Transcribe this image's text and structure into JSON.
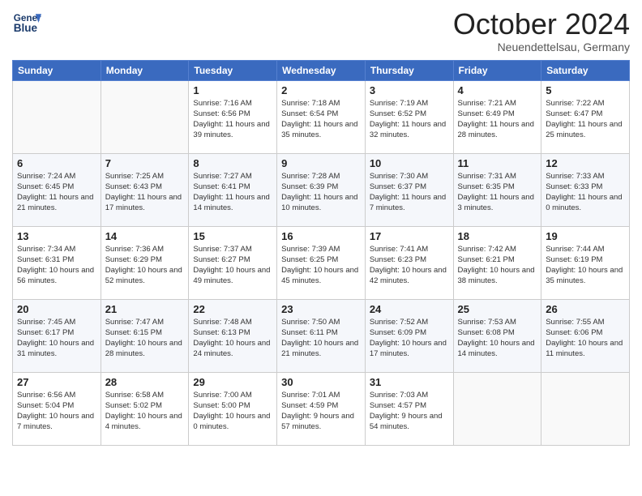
{
  "header": {
    "logo_general": "General",
    "logo_blue": "Blue",
    "title": "October 2024",
    "location": "Neuendettelsau, Germany"
  },
  "weekdays": [
    "Sunday",
    "Monday",
    "Tuesday",
    "Wednesday",
    "Thursday",
    "Friday",
    "Saturday"
  ],
  "weeks": [
    [
      {
        "day": "",
        "sunrise": "",
        "sunset": "",
        "daylight": ""
      },
      {
        "day": "",
        "sunrise": "",
        "sunset": "",
        "daylight": ""
      },
      {
        "day": "1",
        "sunrise": "Sunrise: 7:16 AM",
        "sunset": "Sunset: 6:56 PM",
        "daylight": "Daylight: 11 hours and 39 minutes."
      },
      {
        "day": "2",
        "sunrise": "Sunrise: 7:18 AM",
        "sunset": "Sunset: 6:54 PM",
        "daylight": "Daylight: 11 hours and 35 minutes."
      },
      {
        "day": "3",
        "sunrise": "Sunrise: 7:19 AM",
        "sunset": "Sunset: 6:52 PM",
        "daylight": "Daylight: 11 hours and 32 minutes."
      },
      {
        "day": "4",
        "sunrise": "Sunrise: 7:21 AM",
        "sunset": "Sunset: 6:49 PM",
        "daylight": "Daylight: 11 hours and 28 minutes."
      },
      {
        "day": "5",
        "sunrise": "Sunrise: 7:22 AM",
        "sunset": "Sunset: 6:47 PM",
        "daylight": "Daylight: 11 hours and 25 minutes."
      }
    ],
    [
      {
        "day": "6",
        "sunrise": "Sunrise: 7:24 AM",
        "sunset": "Sunset: 6:45 PM",
        "daylight": "Daylight: 11 hours and 21 minutes."
      },
      {
        "day": "7",
        "sunrise": "Sunrise: 7:25 AM",
        "sunset": "Sunset: 6:43 PM",
        "daylight": "Daylight: 11 hours and 17 minutes."
      },
      {
        "day": "8",
        "sunrise": "Sunrise: 7:27 AM",
        "sunset": "Sunset: 6:41 PM",
        "daylight": "Daylight: 11 hours and 14 minutes."
      },
      {
        "day": "9",
        "sunrise": "Sunrise: 7:28 AM",
        "sunset": "Sunset: 6:39 PM",
        "daylight": "Daylight: 11 hours and 10 minutes."
      },
      {
        "day": "10",
        "sunrise": "Sunrise: 7:30 AM",
        "sunset": "Sunset: 6:37 PM",
        "daylight": "Daylight: 11 hours and 7 minutes."
      },
      {
        "day": "11",
        "sunrise": "Sunrise: 7:31 AM",
        "sunset": "Sunset: 6:35 PM",
        "daylight": "Daylight: 11 hours and 3 minutes."
      },
      {
        "day": "12",
        "sunrise": "Sunrise: 7:33 AM",
        "sunset": "Sunset: 6:33 PM",
        "daylight": "Daylight: 11 hours and 0 minutes."
      }
    ],
    [
      {
        "day": "13",
        "sunrise": "Sunrise: 7:34 AM",
        "sunset": "Sunset: 6:31 PM",
        "daylight": "Daylight: 10 hours and 56 minutes."
      },
      {
        "day": "14",
        "sunrise": "Sunrise: 7:36 AM",
        "sunset": "Sunset: 6:29 PM",
        "daylight": "Daylight: 10 hours and 52 minutes."
      },
      {
        "day": "15",
        "sunrise": "Sunrise: 7:37 AM",
        "sunset": "Sunset: 6:27 PM",
        "daylight": "Daylight: 10 hours and 49 minutes."
      },
      {
        "day": "16",
        "sunrise": "Sunrise: 7:39 AM",
        "sunset": "Sunset: 6:25 PM",
        "daylight": "Daylight: 10 hours and 45 minutes."
      },
      {
        "day": "17",
        "sunrise": "Sunrise: 7:41 AM",
        "sunset": "Sunset: 6:23 PM",
        "daylight": "Daylight: 10 hours and 42 minutes."
      },
      {
        "day": "18",
        "sunrise": "Sunrise: 7:42 AM",
        "sunset": "Sunset: 6:21 PM",
        "daylight": "Daylight: 10 hours and 38 minutes."
      },
      {
        "day": "19",
        "sunrise": "Sunrise: 7:44 AM",
        "sunset": "Sunset: 6:19 PM",
        "daylight": "Daylight: 10 hours and 35 minutes."
      }
    ],
    [
      {
        "day": "20",
        "sunrise": "Sunrise: 7:45 AM",
        "sunset": "Sunset: 6:17 PM",
        "daylight": "Daylight: 10 hours and 31 minutes."
      },
      {
        "day": "21",
        "sunrise": "Sunrise: 7:47 AM",
        "sunset": "Sunset: 6:15 PM",
        "daylight": "Daylight: 10 hours and 28 minutes."
      },
      {
        "day": "22",
        "sunrise": "Sunrise: 7:48 AM",
        "sunset": "Sunset: 6:13 PM",
        "daylight": "Daylight: 10 hours and 24 minutes."
      },
      {
        "day": "23",
        "sunrise": "Sunrise: 7:50 AM",
        "sunset": "Sunset: 6:11 PM",
        "daylight": "Daylight: 10 hours and 21 minutes."
      },
      {
        "day": "24",
        "sunrise": "Sunrise: 7:52 AM",
        "sunset": "Sunset: 6:09 PM",
        "daylight": "Daylight: 10 hours and 17 minutes."
      },
      {
        "day": "25",
        "sunrise": "Sunrise: 7:53 AM",
        "sunset": "Sunset: 6:08 PM",
        "daylight": "Daylight: 10 hours and 14 minutes."
      },
      {
        "day": "26",
        "sunrise": "Sunrise: 7:55 AM",
        "sunset": "Sunset: 6:06 PM",
        "daylight": "Daylight: 10 hours and 11 minutes."
      }
    ],
    [
      {
        "day": "27",
        "sunrise": "Sunrise: 6:56 AM",
        "sunset": "Sunset: 5:04 PM",
        "daylight": "Daylight: 10 hours and 7 minutes."
      },
      {
        "day": "28",
        "sunrise": "Sunrise: 6:58 AM",
        "sunset": "Sunset: 5:02 PM",
        "daylight": "Daylight: 10 hours and 4 minutes."
      },
      {
        "day": "29",
        "sunrise": "Sunrise: 7:00 AM",
        "sunset": "Sunset: 5:00 PM",
        "daylight": "Daylight: 10 hours and 0 minutes."
      },
      {
        "day": "30",
        "sunrise": "Sunrise: 7:01 AM",
        "sunset": "Sunset: 4:59 PM",
        "daylight": "Daylight: 9 hours and 57 minutes."
      },
      {
        "day": "31",
        "sunrise": "Sunrise: 7:03 AM",
        "sunset": "Sunset: 4:57 PM",
        "daylight": "Daylight: 9 hours and 54 minutes."
      },
      {
        "day": "",
        "sunrise": "",
        "sunset": "",
        "daylight": ""
      },
      {
        "day": "",
        "sunrise": "",
        "sunset": "",
        "daylight": ""
      }
    ]
  ]
}
